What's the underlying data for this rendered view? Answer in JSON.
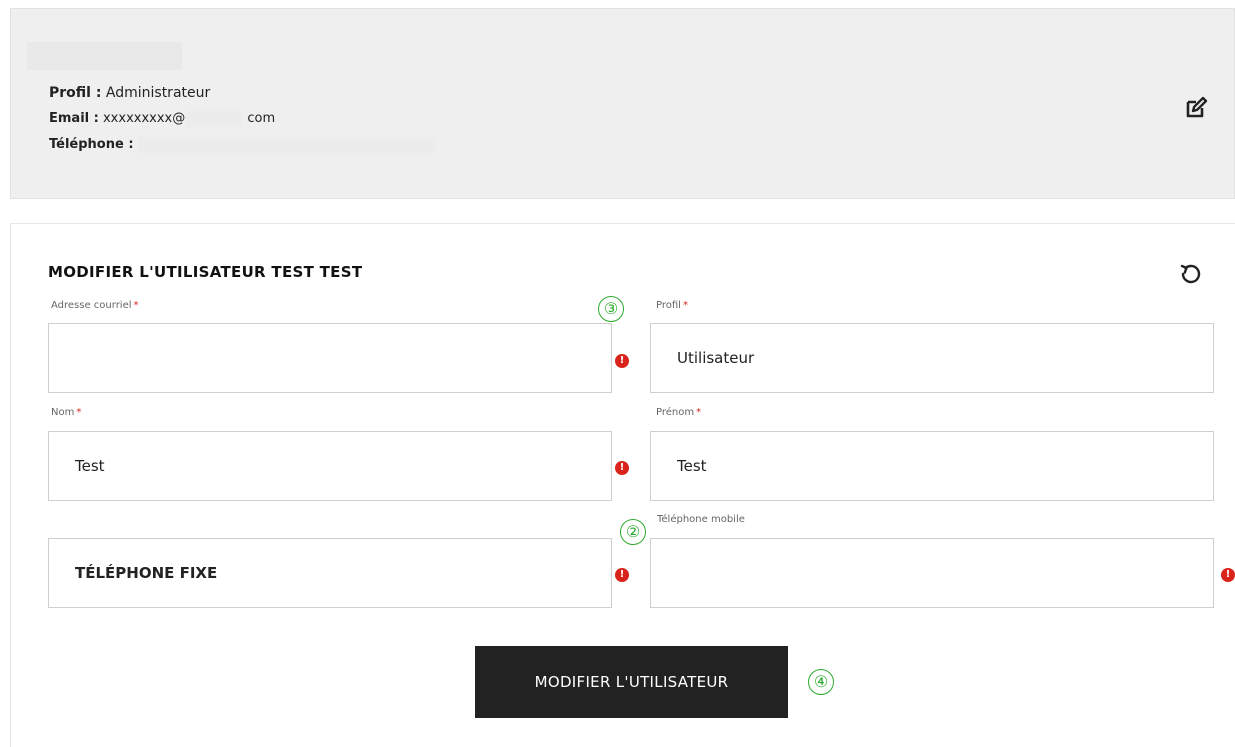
{
  "profile": {
    "profil_label": "Profil :",
    "profil_value": "Administrateur",
    "email_label": "Email :",
    "email_prefix": "xxxxxxxxx@",
    "email_suffix": "com",
    "phone_label": "Téléphone :"
  },
  "form": {
    "title": "MODIFIER L'UTILISATEUR TEST TEST",
    "required_mark": "*",
    "email": {
      "label": "Adresse courriel",
      "value": ""
    },
    "profil": {
      "label": "Profil",
      "value": "Utilisateur",
      "options": [
        "Utilisateur"
      ]
    },
    "nom": {
      "label": "Nom",
      "value": "Test"
    },
    "prenom": {
      "label": "Prénom",
      "value": "Test"
    },
    "fixe": {
      "placeholder": "TÉLÉPHONE FIXE",
      "value": ""
    },
    "mobile": {
      "label": "Téléphone mobile",
      "value": ""
    },
    "error_glyph": "!",
    "submit_label": "MODIFIER L'UTILISATEUR"
  },
  "annotations": {
    "step_2": "②",
    "step_3": "③",
    "step_4": "④",
    "color": "#2eaa2e"
  },
  "icons": {
    "edit": "edit-icon",
    "reset": "reset-icon",
    "error": "error-icon"
  },
  "colors": {
    "error": "#d9241c",
    "button_bg": "#222222",
    "card_bg": "#efefef"
  }
}
